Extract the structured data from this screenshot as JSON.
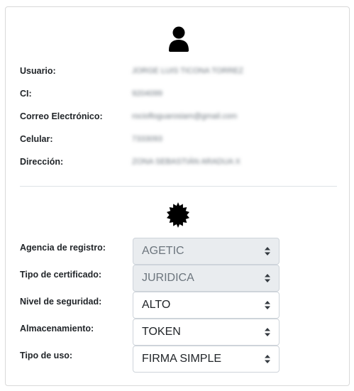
{
  "user": {
    "fields": [
      {
        "label": "Usuario:",
        "value": "JORGE LUIS TICONA TORREZ"
      },
      {
        "label": "CI:",
        "value": "9204099"
      },
      {
        "label": "Correo Electrónico:",
        "value": "rociofloguarosiam@gmail.com"
      },
      {
        "label": "Celular:",
        "value": "7333093"
      },
      {
        "label": "Dirección:",
        "value": "ZONA SEBASTIÁN ARADUA X"
      }
    ]
  },
  "certificate": {
    "fields": [
      {
        "label": "Agencia de registro:",
        "value": "AGETIC",
        "disabled": true
      },
      {
        "label": "Tipo de certificado:",
        "value": "JURIDICA",
        "disabled": true
      },
      {
        "label": "Nivel de seguridad:",
        "value": "ALTO",
        "disabled": false
      },
      {
        "label": "Almacenamiento:",
        "value": "TOKEN",
        "disabled": false
      },
      {
        "label": "Tipo de uso:",
        "value": "FIRMA SIMPLE",
        "disabled": false
      }
    ]
  },
  "icons": {
    "user": "user-icon",
    "certificate": "certificate-seal-icon",
    "select_caret": "sort-caret-icon"
  },
  "colors": {
    "label_text": "#212529",
    "disabled_bg": "#e9ecef",
    "border": "#ced4da"
  }
}
